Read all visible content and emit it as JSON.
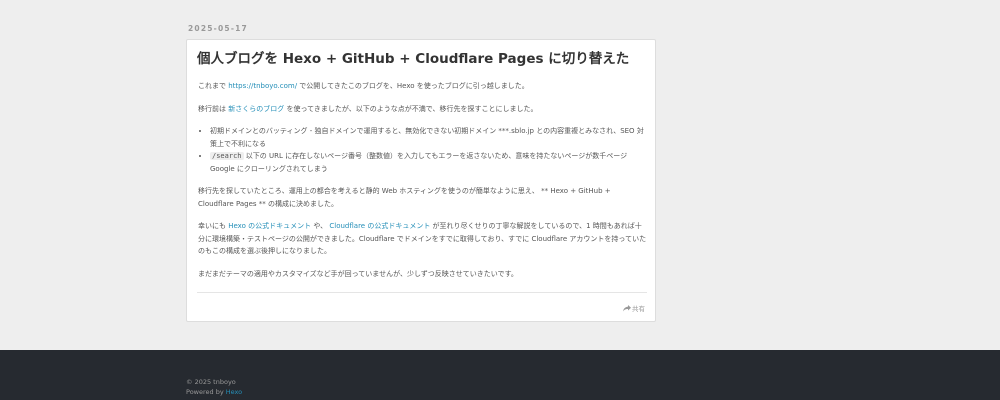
{
  "post": {
    "date": "2025-05-17",
    "title": "個人ブログを Hexo + GitHub + Cloudflare Pages に切り替えた",
    "p1": {
      "before": "これまで ",
      "link": "https://tnboyo.com/",
      "after": " で公開してきたこのブログを、Hexo を使ったブログに引っ越しました。"
    },
    "p2": {
      "before": "移行前は ",
      "link": "新さくらのブログ",
      "after": " を使ってきましたが、以下のような点が不満で、移行先を探すことにしました。"
    },
    "list": {
      "item1": "初期ドメインとのバッティング - 独自ドメインで運用すると、無効化できない初期ドメイン ***.sblo.jp との内容重複とみなされ、SEO 対策上で不利になる",
      "item2_code": "/search",
      "item2_after": " 以下の URL に存在しないページ番号（整数値）を入力してもエラーを返さないため、意味を持たないページが数千ページ Google にクローリングされてしまう"
    },
    "p3": "移行先を探していたところ、運用上の都合を考えると静的 Web ホスティングを使うのが簡単なように思え、 ** Hexo + GitHub + Cloudflare Pages ** の構成に決めました。",
    "p4": {
      "before": "幸いにも ",
      "link1": "Hexo の公式ドキュメント",
      "middle": " や、 ",
      "link2": "Cloudflare の公式ドキュメント",
      "after": " が至れり尽くせりの丁寧な解説をしているので、1 時間もあれば十分に環境構築・テストページの公開ができました。Cloudflare でドメインをすでに取得しており、すでに Cloudflare アカウントを持っていたのもこの構成を選ぶ後押しになりました。"
    },
    "p5": "まだまだテーマの適用やカスタマイズなど手が回っていませんが、少しずつ反映させていきたいです。",
    "share_label": "共有",
    "share_icon": "share-icon"
  },
  "footer": {
    "copyright": "© 2025 tnboyo",
    "powered_prefix": "Powered by ",
    "powered_link": "Hexo"
  },
  "colors": {
    "background": "#eeeeee",
    "link": "#258fb8",
    "footer_bg": "#262a30"
  }
}
